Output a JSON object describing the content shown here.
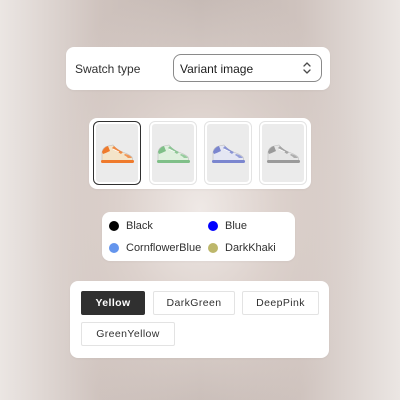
{
  "swatch_type": {
    "label": "Swatch type",
    "selected_value": "Variant image"
  },
  "image_swatches": [
    {
      "name": "orange-cream-sneaker",
      "selected": true,
      "accent": "#ef7a2c",
      "upper": "#f4e4c9"
    },
    {
      "name": "green-sneaker",
      "selected": false,
      "accent": "#7fbf88",
      "upper": "#dff0de"
    },
    {
      "name": "blue-sneaker",
      "selected": false,
      "accent": "#7b86cf",
      "upper": "#e4e6f3"
    },
    {
      "name": "grey-sneaker",
      "selected": false,
      "accent": "#9a9a9a",
      "upper": "#e6e6e6"
    }
  ],
  "color_swatches": [
    {
      "label": "Black",
      "color": "#000000"
    },
    {
      "label": "Blue",
      "color": "#0000ff"
    },
    {
      "label": "CornflowerBlue",
      "color": "#6495ed"
    },
    {
      "label": "DarkKhaki",
      "color": "#bdb76b"
    }
  ],
  "text_swatches": [
    {
      "label": "Yellow",
      "selected": true
    },
    {
      "label": "DarkGreen",
      "selected": false
    },
    {
      "label": "DeepPink",
      "selected": false
    },
    {
      "label": "GreenYellow",
      "selected": false
    }
  ]
}
